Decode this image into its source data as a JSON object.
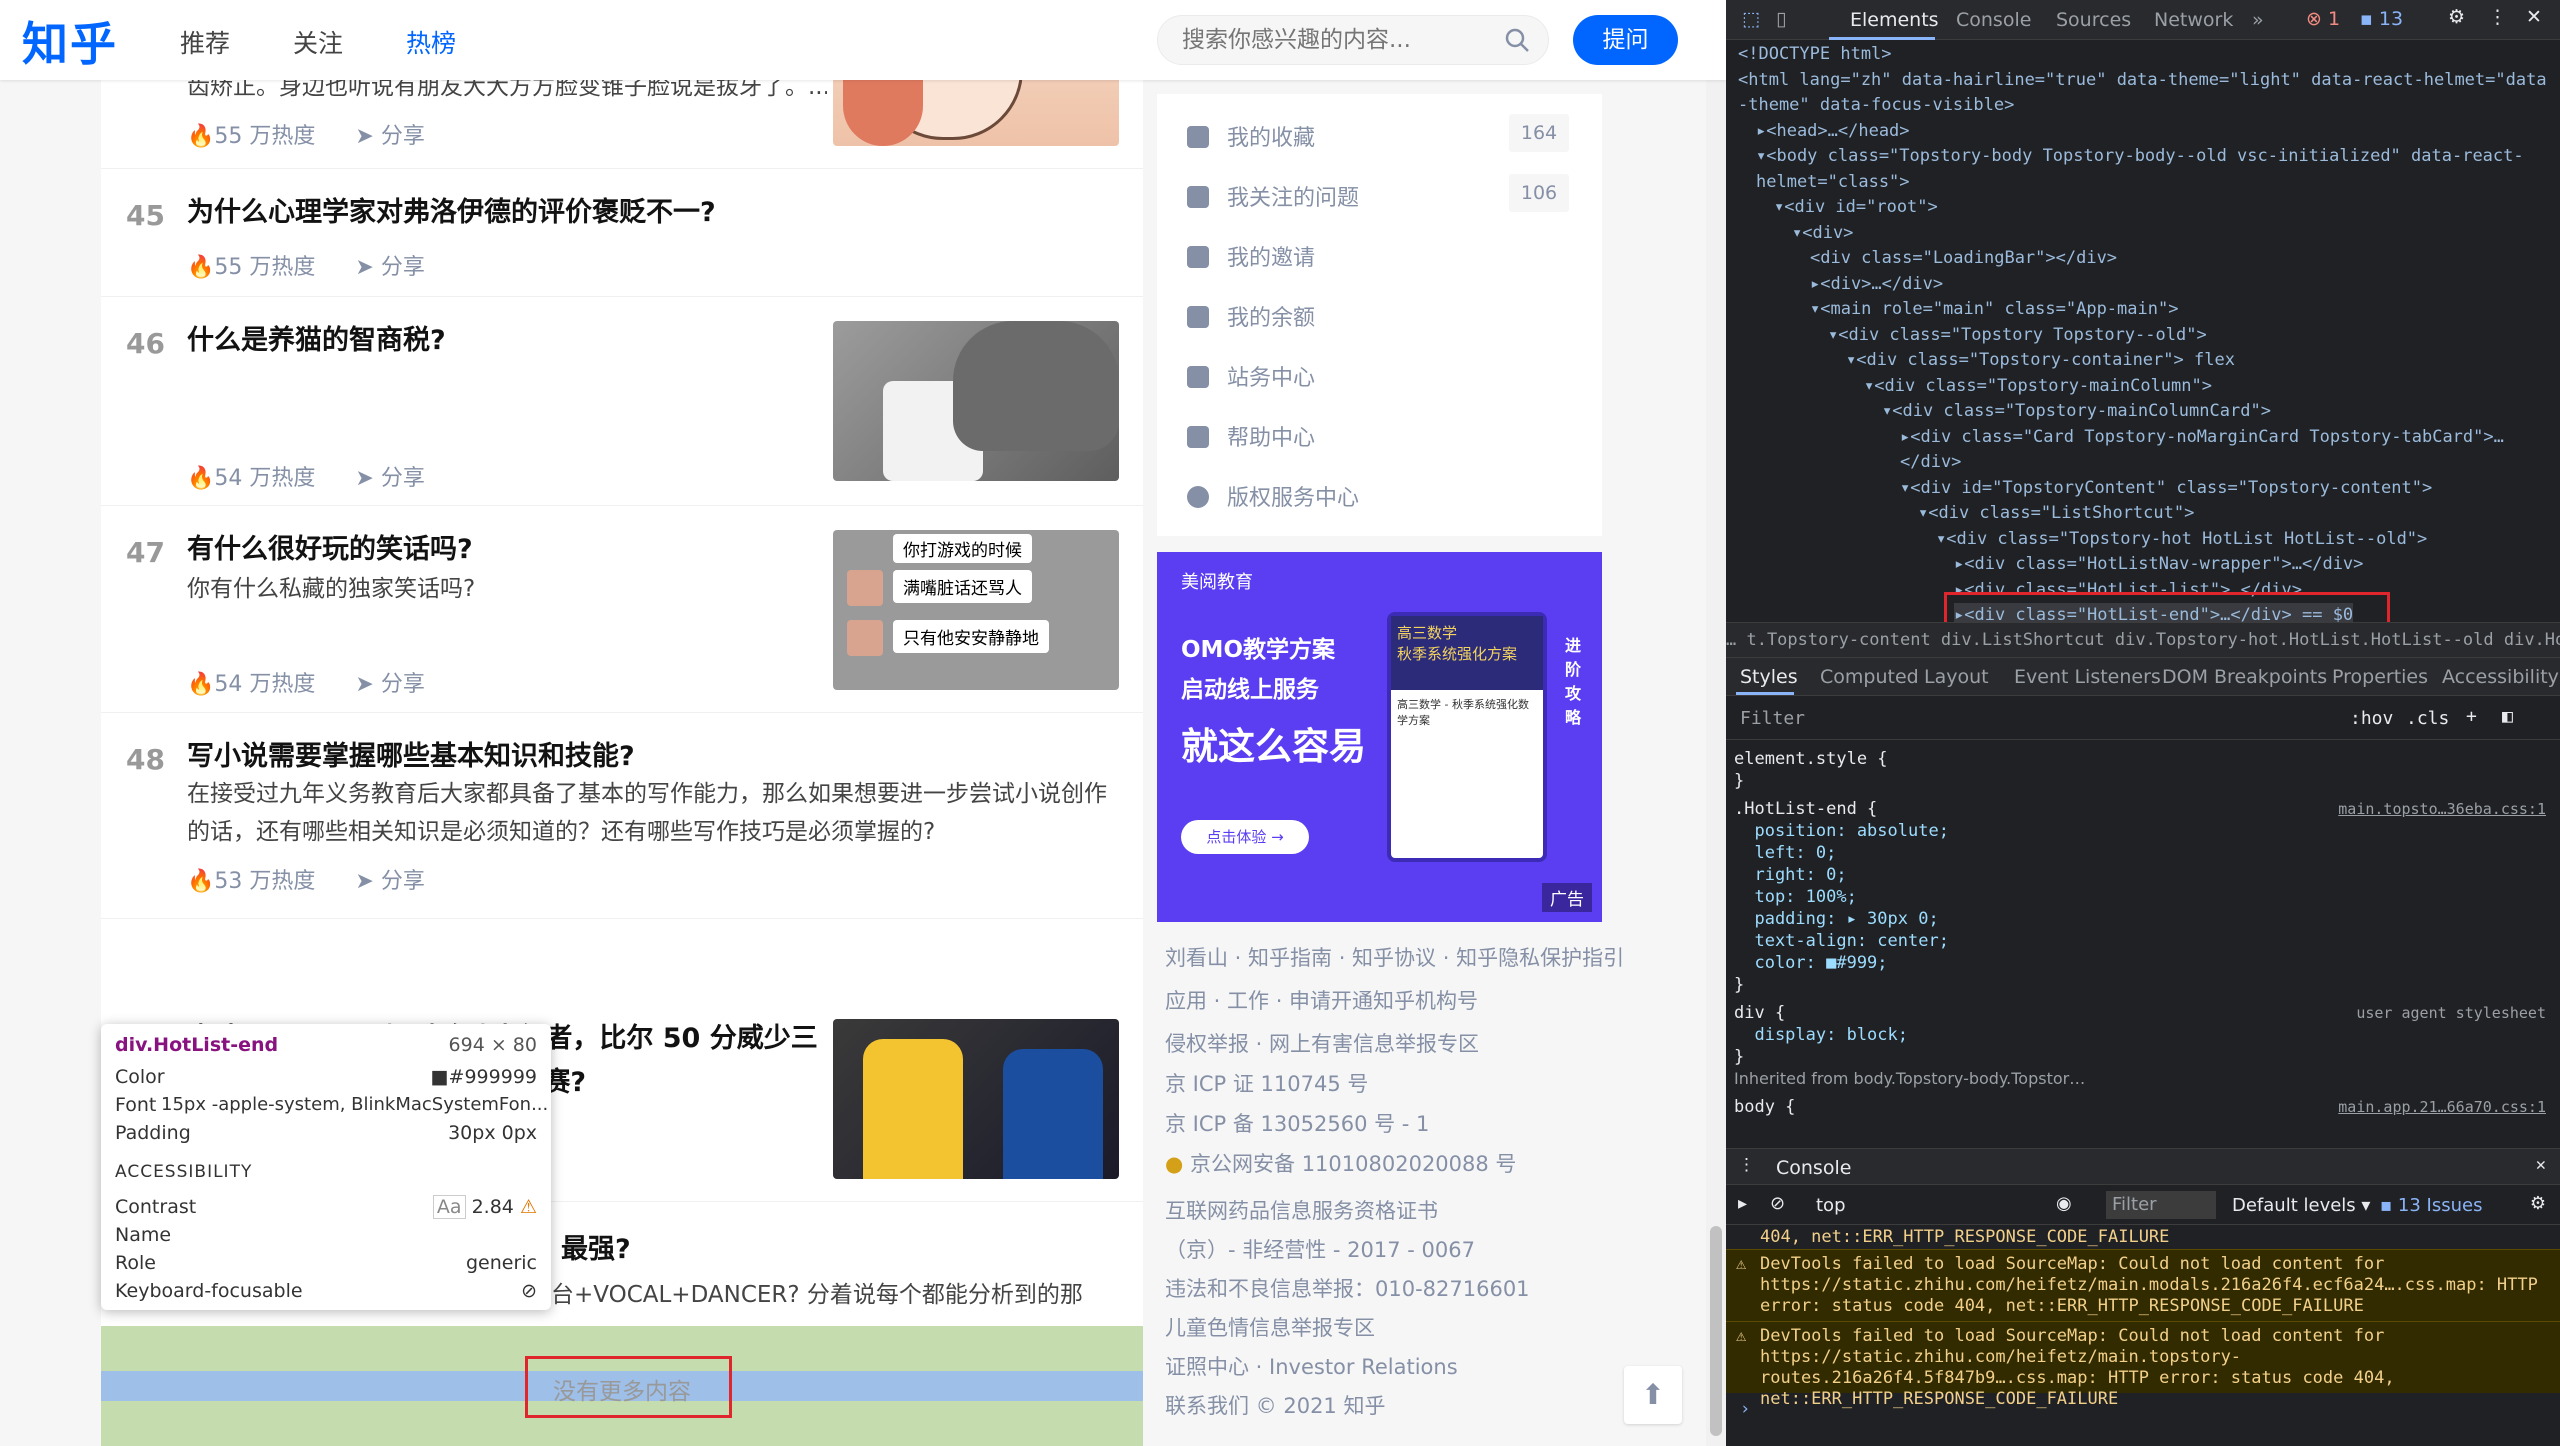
{
  "header": {
    "logo": "知乎",
    "nav": [
      "推荐",
      "关注",
      "热榜"
    ],
    "active_nav": "热榜",
    "search_placeholder": "搜索你感兴趣的内容...",
    "ask_label": "提问"
  },
  "hot_items": [
    {
      "rank": "",
      "title": "",
      "excerpt": "齿矫正。身边也听说有朋友大大方方脸变锥子脸说是拔牙了。...",
      "heat": "55 万热度",
      "share": "分享",
      "thumb": "anime"
    },
    {
      "rank": "45",
      "title": "为什么心理学家对弗洛伊德的评价褒贬不一?",
      "excerpt": "",
      "heat": "55 万热度",
      "share": "分享",
      "thumb": ""
    },
    {
      "rank": "46",
      "title": "什么是养猫的智商税?",
      "excerpt": "",
      "heat": "54 万热度",
      "share": "分享",
      "thumb": "cat"
    },
    {
      "rank": "47",
      "title": "有什么很好玩的笑话吗?",
      "excerpt": "你有什么私藏的独家笑话吗?",
      "heat": "54 万热度",
      "share": "分享",
      "thumb": "chat"
    },
    {
      "rank": "48",
      "title": "写小说需要掌握哪些基本知识和技能?",
      "excerpt": "在接受过九年义务教育后大家都具备了基本的写作能力，那么如果想要进一步尝试小说创作的话，还有哪些相关知识是必须知道的？还有哪些写作技巧是必须掌握的?",
      "heat": "53 万热度",
      "share": "分享",
      "thumb": ""
    },
    {
      "rank": "49",
      "title": "奇才 133:132 加时险胜步行者，比尔 50 分威少三双追平大 O，如何评价这场比赛?",
      "excerpt": "",
      "heat": "",
      "share": "",
      "thumb": "basketball"
    },
    {
      "rank": "",
      "title": "最强?",
      "excerpt": "台+VOCAL+DANCER? 分着说每个都能分析到的那",
      "heat": "",
      "share": "",
      "thumb": ""
    }
  ],
  "chat_bubbles": [
    "你打游戏的时候",
    "满嘴脏话还骂人",
    "只有他安安静静地"
  ],
  "hot_end": "没有更多内容",
  "tooltip": {
    "selector": "div.HotList-end",
    "size": "694 × 80",
    "color_label": "Color",
    "color_value": "#999999",
    "font_label": "Font",
    "font_value": "15px -apple-system, BlinkMacSystemFon...",
    "padding_label": "Padding",
    "padding_value": "30px 0px",
    "accessibility": "ACCESSIBILITY",
    "contrast_label": "Contrast",
    "contrast_aa": "Aa",
    "contrast_value": "2.84",
    "name_label": "Name",
    "role_label": "Role",
    "role_value": "generic",
    "focus_label": "Keyboard-focusable"
  },
  "sidebar": {
    "items": [
      {
        "label": "我的收藏",
        "count": "164"
      },
      {
        "label": "我关注的问题",
        "count": "106"
      },
      {
        "label": "我的邀请",
        "count": ""
      },
      {
        "label": "我的余额",
        "count": ""
      },
      {
        "label": "站务中心",
        "count": ""
      },
      {
        "label": "帮助中心",
        "count": ""
      },
      {
        "label": "版权服务中心",
        "count": ""
      }
    ]
  },
  "ad": {
    "brand": "美阅教育",
    "line1": "OMO教学方案",
    "line2": "启动线上服务",
    "line3": "就这么容易",
    "cta": "点击体验 →",
    "tag": "广告",
    "card_title": "高三数学",
    "card_sub": "秋季系统强化方案",
    "card_text": "高三数学 - 秋季系统强化数学方案",
    "side_text": "进阶攻略"
  },
  "footer": [
    "刘看山 · 知乎指南 · 知乎协议 · 知乎隐私保护指引",
    "应用 · 工作 · 申请开通知乎机构号",
    "侵权举报 · 网上有害信息举报专区",
    "京 ICP 证 110745 号",
    "京 ICP 备 13052560 号 - 1",
    "京公网安备 11010802020088 号",
    "互联网药品信息服务资格证书",
    "（京）- 非经营性 - 2017 - 0067",
    "违法和不良信息举报：010-82716601",
    "儿童色情信息举报专区",
    "证照中心 · Investor Relations",
    "联系我们 © 2021 知乎"
  ],
  "devtools": {
    "tabs": [
      "Elements",
      "Console",
      "Sources",
      "Network",
      "»"
    ],
    "errors": "1",
    "issues": "13",
    "dom_lines": [
      {
        "indent": 0,
        "text": "<!DOCTYPE html>"
      },
      {
        "indent": 0,
        "text": "<html lang=\"zh\" data-hairline=\"true\" data-theme=\"light\" data-react-helmet=\"data"
      },
      {
        "indent": 0,
        "text": "-theme\" data-focus-visible>"
      },
      {
        "indent": 1,
        "text": "▸<head>…</head>"
      },
      {
        "indent": 1,
        "text": "▾<body class=\"Topstory-body Topstory-body--old vsc-initialized\" data-react-"
      },
      {
        "indent": 1,
        "text": "helmet=\"class\">"
      },
      {
        "indent": 2,
        "text": "▾<div id=\"root\">"
      },
      {
        "indent": 3,
        "text": "▾<div>"
      },
      {
        "indent": 4,
        "text": "<div class=\"LoadingBar\"></div>"
      },
      {
        "indent": 4,
        "text": "▸<div>…</div>"
      },
      {
        "indent": 4,
        "text": "▾<main role=\"main\" class=\"App-main\">"
      },
      {
        "indent": 5,
        "text": "▾<div class=\"Topstory Topstory--old\">"
      },
      {
        "indent": 6,
        "text": "▾<div class=\"Topstory-container\"> flex"
      },
      {
        "indent": 7,
        "text": "▾<div class=\"Topstory-mainColumn\">"
      },
      {
        "indent": 8,
        "text": "▾<div class=\"Topstory-mainColumnCard\">"
      },
      {
        "indent": 9,
        "text": "▸<div class=\"Card Topstory-noMarginCard Topstory-tabCard\">…"
      },
      {
        "indent": 9,
        "text": "</div>"
      },
      {
        "indent": 9,
        "text": "▾<div id=\"TopstoryContent\" class=\"Topstory-content\">"
      },
      {
        "indent": 10,
        "text": "▾<div class=\"ListShortcut\">"
      },
      {
        "indent": 11,
        "text": "▾<div class=\"Topstory-hot HotList HotList--old\">"
      },
      {
        "indent": 12,
        "text": "▸<div class=\"HotListNav-wrapper\">…</div>"
      },
      {
        "indent": 12,
        "text": "▸<div class=\"HotList-list\">…</div>"
      },
      {
        "indent": 12,
        "text": "▸<div class=\"HotList-end\">…</div> == $0"
      }
    ],
    "breadcrumb": "…  t.Topstory-content   div.ListShortcut   div.Topstory-hot.HotList.HotList--old   div.HotList-end   …",
    "style_tabs": [
      "Styles",
      "Computed",
      "Layout",
      "Event Listeners",
      "DOM Breakpoints",
      "Properties",
      "Accessibility"
    ],
    "filter_placeholder": "Filter",
    "hov": ":hov",
    "cls": ".cls",
    "rules": [
      {
        "text": "element.style {",
        "type": "sel"
      },
      {
        "text": "}",
        "type": "plain"
      },
      {
        "text": ".HotList-end {",
        "type": "sel",
        "source": "main.topsto…36eba.css:1"
      },
      {
        "text": "  position: absolute;",
        "type": "prop"
      },
      {
        "text": "  left: 0;",
        "type": "prop"
      },
      {
        "text": "  right: 0;",
        "type": "prop"
      },
      {
        "text": "  top: 100%;",
        "type": "prop"
      },
      {
        "text": "  padding: ▸ 30px 0;",
        "type": "prop"
      },
      {
        "text": "  text-align: center;",
        "type": "prop"
      },
      {
        "text": "  color: ■#999;",
        "type": "prop"
      },
      {
        "text": "}",
        "type": "plain"
      },
      {
        "text": "div {",
        "type": "sel",
        "source": "user agent stylesheet"
      },
      {
        "text": "  display: block;",
        "type": "prop"
      },
      {
        "text": "}",
        "type": "plain"
      },
      {
        "text": "Inherited from body.Topstory-body.Topstor…",
        "type": "inh"
      },
      {
        "text": "body {",
        "type": "sel",
        "source": "main.app.21…66a70.css:1"
      }
    ],
    "console_title": "Console",
    "console_context": "top",
    "console_filter": "Filter",
    "console_levels": "Default levels ▾",
    "console_issues": "13 Issues",
    "console_lines": [
      "404, net::ERR_HTTP_RESPONSE_CODE_FAILURE",
      "DevTools failed to load SourceMap: Could not load content for https://static.zhihu.com/heifetz/main.modals.216a26f4.ecf6a24….css.map: HTTP error: status code 404, net::ERR_HTTP_RESPONSE_CODE_FAILURE",
      "DevTools failed to load SourceMap: Could not load content for https://static.zhihu.com/heifetz/main.topstory-routes.216a26f4.5f847b9….css.map: HTTP error: status code 404, net::ERR_HTTP_RESPONSE_CODE_FAILURE"
    ]
  }
}
